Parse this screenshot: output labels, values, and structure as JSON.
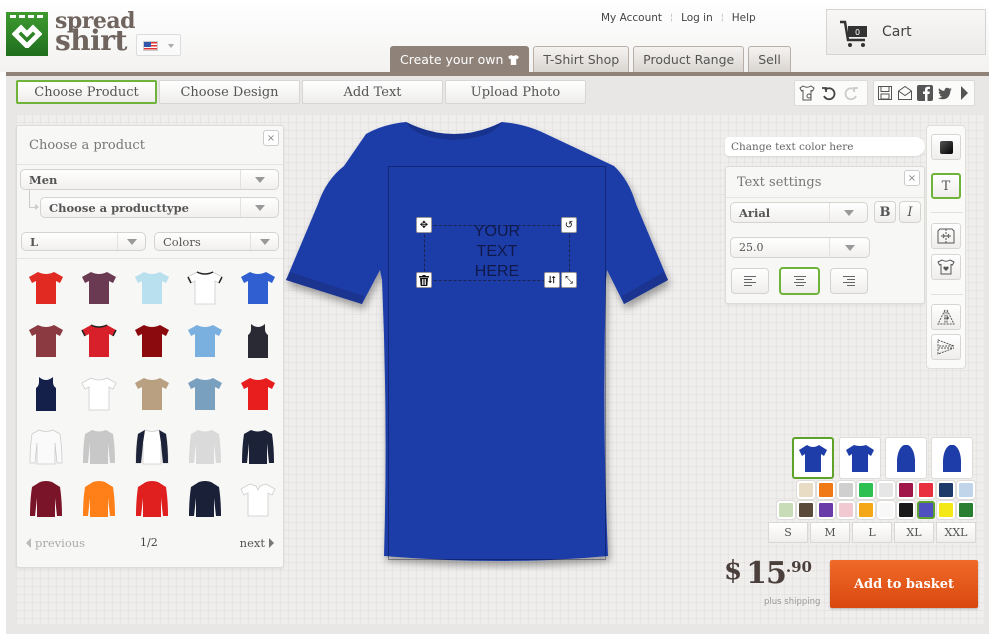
{
  "brand": {
    "line1": "spread",
    "line2": "shirt",
    "color": "#2e8a28"
  },
  "locale": {
    "flag": "us-flag-icon"
  },
  "top_links": [
    "My Account",
    "Log in",
    "Help"
  ],
  "cart": {
    "label": "Cart",
    "count": "0"
  },
  "main_tabs": [
    {
      "label": "Create your own",
      "active": true
    },
    {
      "label": "T-Shirt Shop",
      "active": false
    },
    {
      "label": "Product Range",
      "active": false
    },
    {
      "label": "Sell",
      "active": false
    }
  ],
  "step_tabs": [
    {
      "label": "Choose Product",
      "active": true
    },
    {
      "label": "Choose Design",
      "active": false
    },
    {
      "label": "Add Text",
      "active": false
    },
    {
      "label": "Upload Photo",
      "active": false
    }
  ],
  "toolbar_edit": [
    "product-settings-icon",
    "undo-icon",
    "redo-icon"
  ],
  "toolbar_share": [
    "save-icon",
    "email-icon",
    "facebook-icon",
    "twitter-icon",
    "more-arrow-icon"
  ],
  "product_panel": {
    "title": "Choose a product",
    "close": "×",
    "category": "Men",
    "product_type": "Choose a producttype",
    "size": "L",
    "colors": "Colors",
    "products": [
      {
        "color": "#e02a22",
        "type": "tee"
      },
      {
        "color": "#6a3a52",
        "type": "tee"
      },
      {
        "color": "#b8e0ee",
        "type": "tee"
      },
      {
        "color": "#ffffff",
        "type": "ringer"
      },
      {
        "color": "#2f5fd0",
        "type": "tee"
      },
      {
        "color": "#8a3a40",
        "type": "tee"
      },
      {
        "color": "#d8202a",
        "type": "ringer"
      },
      {
        "color": "#8a0a0e",
        "type": "tee"
      },
      {
        "color": "#7ab0e0",
        "type": "tee"
      },
      {
        "color": "#2a2a35",
        "type": "tank"
      },
      {
        "color": "#14204a",
        "type": "tank"
      },
      {
        "color": "#ffffff",
        "type": "tee"
      },
      {
        "color": "#b8a080",
        "type": "tee"
      },
      {
        "color": "#7aa0c0",
        "type": "tee"
      },
      {
        "color": "#e81e1e",
        "type": "tee"
      },
      {
        "color": "#fafafa",
        "type": "longsleeve"
      },
      {
        "color": "#c8c8c8",
        "type": "sweater"
      },
      {
        "color": "#ffffff",
        "type": "raglan"
      },
      {
        "color": "#dadada",
        "type": "longsleeve"
      },
      {
        "color": "#1c2238",
        "type": "longsleeve"
      },
      {
        "color": "#7a1428",
        "type": "hoodie"
      },
      {
        "color": "#ff8018",
        "type": "hoodie"
      },
      {
        "color": "#e0201e",
        "type": "jacket"
      },
      {
        "color": "#1a2038",
        "type": "hoodie"
      },
      {
        "color": "#ffffff",
        "type": "polo"
      }
    ],
    "pager": {
      "previous": "previous",
      "page": "1/2",
      "next": "next"
    }
  },
  "design": {
    "shirt_color": "#1f3da8",
    "text_lines": [
      "YOUR",
      "TEXT",
      "HERE"
    ],
    "handles": [
      "move-icon",
      "rotate-icon",
      "delete-icon",
      "flip-icon",
      "resize-icon"
    ]
  },
  "text_panel": {
    "hint": "Change text color here",
    "title": "Text settings",
    "close": "×",
    "font": "Arial",
    "bold": "B",
    "italic": "I",
    "size": "25.0",
    "alignment": [
      "left",
      "center",
      "right"
    ],
    "active_alignment": "center"
  },
  "side_toolbar": {
    "text_button": "T",
    "active": "text"
  },
  "views": [
    "front",
    "back",
    "left-sleeve",
    "right-sleeve"
  ],
  "active_view": "front",
  "swatches_row1": [
    "#e8dcc4",
    "#f07a18",
    "#cfcfcf",
    "#2ec050",
    "#e6e6e6",
    "#a0184a",
    "#e83040",
    "#1e3a6a",
    "#c0d4ea"
  ],
  "swatches_row2": [
    "#c8dcb8",
    "#5a4a3a",
    "#6a3ca8",
    "#f0cad0",
    "#f4a818",
    "#f8f8f8",
    "#1a1a1a",
    "#4f4fc0",
    "#f4e818",
    "#2a8030"
  ],
  "active_swatch": "#4f4fc0",
  "sizes": [
    "S",
    "M",
    "L",
    "XL",
    "XXL"
  ],
  "price": {
    "currency": "$",
    "integer": "15",
    "decimal": ".90",
    "note": "plus shipping"
  },
  "add_to_basket": "Add to basket"
}
